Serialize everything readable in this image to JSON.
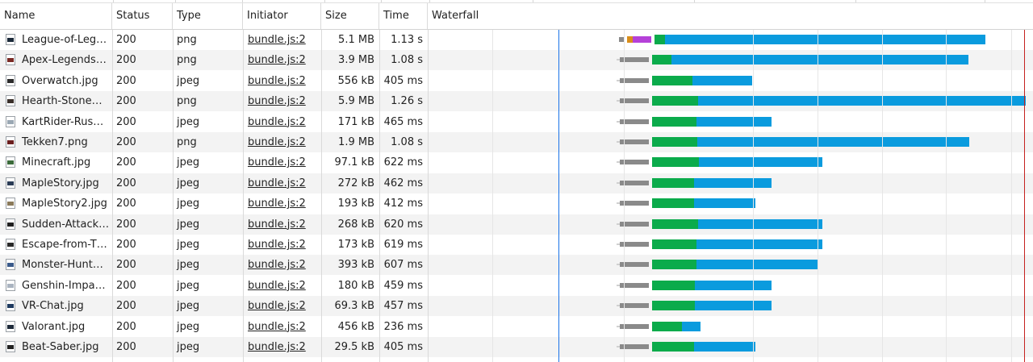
{
  "columns": {
    "name": "Name",
    "status": "Status",
    "type": "Type",
    "initiator": "Initiator",
    "size": "Size",
    "time": "Time",
    "waterfall": "Waterfall"
  },
  "colors": {
    "stalled": "#8a8a8a",
    "waiting_ttfb": "#0bab4b",
    "content_download": "#0a9bde",
    "dns": "#d98e1a",
    "ssl": "#b541d8",
    "dom_content_loaded_line": "#1a73e8",
    "load_line": "#c5221f"
  },
  "rows": [
    {
      "name": "League-of-Leg…",
      "status": "200",
      "type": "png",
      "initiator": "bundle.js:2",
      "size": "5.1 MB",
      "time": "1.13 s",
      "icon": "png-file-icon",
      "thumb": "#1b2a3a"
    },
    {
      "name": "Apex-Legends…",
      "status": "200",
      "type": "png",
      "initiator": "bundle.js:2",
      "size": "3.9 MB",
      "time": "1.08 s",
      "icon": "png-file-icon",
      "thumb": "#7a2a25"
    },
    {
      "name": "Overwatch.jpg",
      "status": "200",
      "type": "jpeg",
      "initiator": "bundle.js:2",
      "size": "556 kB",
      "time": "405 ms",
      "icon": "jpeg-file-icon",
      "thumb": "#2b2b2b"
    },
    {
      "name": "Hearth-Stone…",
      "status": "200",
      "type": "png",
      "initiator": "bundle.js:2",
      "size": "5.9 MB",
      "time": "1.26 s",
      "icon": "png-file-icon",
      "thumb": "#3a2f2a"
    },
    {
      "name": "KartRider-Rus…",
      "status": "200",
      "type": "jpeg",
      "initiator": "bundle.js:2",
      "size": "171 kB",
      "time": "465 ms",
      "icon": "jpeg-file-icon",
      "thumb": "#9aa7b3"
    },
    {
      "name": "Tekken7.png",
      "status": "200",
      "type": "png",
      "initiator": "bundle.js:2",
      "size": "1.9 MB",
      "time": "1.08 s",
      "icon": "png-file-icon",
      "thumb": "#6a1e1e"
    },
    {
      "name": "Minecraft.jpg",
      "status": "200",
      "type": "jpeg",
      "initiator": "bundle.js:2",
      "size": "97.1 kB",
      "time": "622 ms",
      "icon": "jpeg-file-icon",
      "thumb": "#3b6b3b"
    },
    {
      "name": "MapleStory.jpg",
      "status": "200",
      "type": "jpeg",
      "initiator": "bundle.js:2",
      "size": "272 kB",
      "time": "462 ms",
      "icon": "jpeg-file-icon",
      "thumb": "#2a3b55"
    },
    {
      "name": "MapleStory2.jpg",
      "status": "200",
      "type": "jpeg",
      "initiator": "bundle.js:2",
      "size": "193 kB",
      "time": "412 ms",
      "icon": "jpeg-file-icon",
      "thumb": "#8a7a5a"
    },
    {
      "name": "Sudden-Attack…",
      "status": "200",
      "type": "jpeg",
      "initiator": "bundle.js:2",
      "size": "268 kB",
      "time": "620 ms",
      "icon": "jpeg-file-icon",
      "thumb": "#1f1f1f"
    },
    {
      "name": "Escape-from-T…",
      "status": "200",
      "type": "jpeg",
      "initiator": "bundle.js:2",
      "size": "173 kB",
      "time": "619 ms",
      "icon": "jpeg-file-icon",
      "thumb": "#2a2a2a"
    },
    {
      "name": "Monster-Hunt…",
      "status": "200",
      "type": "jpeg",
      "initiator": "bundle.js:2",
      "size": "393 kB",
      "time": "607 ms",
      "icon": "jpeg-file-icon",
      "thumb": "#3a5a8a"
    },
    {
      "name": "Genshin-Impa…",
      "status": "200",
      "type": "jpeg",
      "initiator": "bundle.js:2",
      "size": "180 kB",
      "time": "459 ms",
      "icon": "jpeg-file-icon",
      "thumb": "#aab4c0"
    },
    {
      "name": "VR-Chat.jpg",
      "status": "200",
      "type": "jpeg",
      "initiator": "bundle.js:2",
      "size": "69.3 kB",
      "time": "457 ms",
      "icon": "jpeg-file-icon",
      "thumb": "#1e3a5f"
    },
    {
      "name": "Valorant.jpg",
      "status": "200",
      "type": "jpeg",
      "initiator": "bundle.js:2",
      "size": "456 kB",
      "time": "236 ms",
      "icon": "jpeg-file-icon",
      "thumb": "#1e2a3a"
    },
    {
      "name": "Beat-Saber.jpg",
      "status": "200",
      "type": "jpeg",
      "initiator": "bundle.js:2",
      "size": "29.5 kB",
      "time": "405 ms",
      "icon": "jpeg-file-icon",
      "thumb": "#222222"
    },
    {
      "name": "",
      "status": "",
      "type": "",
      "initiator": "",
      "size": "",
      "time": "",
      "icon": "",
      "thumb": ""
    }
  ]
}
